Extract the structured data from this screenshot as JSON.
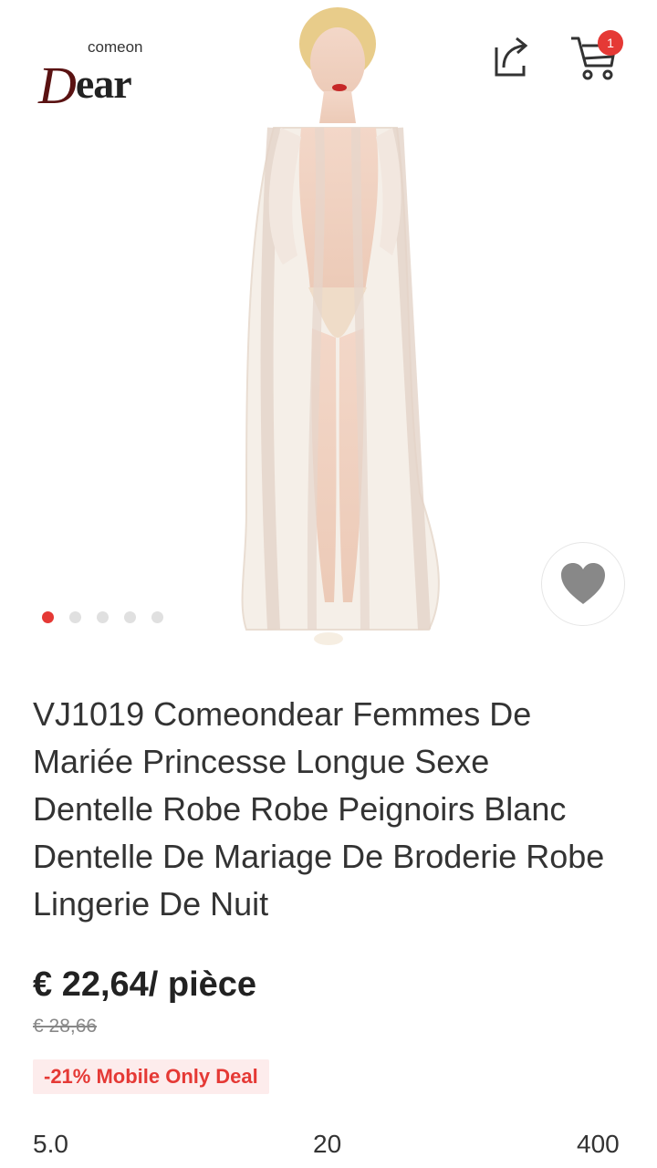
{
  "header": {
    "logo_small": "comeon",
    "logo_big_d": "D",
    "logo_big_rest": "ear",
    "cart_count": "1"
  },
  "gallery": {
    "image_count": 5,
    "active_index": 0
  },
  "product": {
    "title": "VJ1019 Comeondear Femmes De Mariée Princesse Longue Sexe Dentelle Robe Robe Peignoirs Blanc Dentelle De Mariage De Broderie Robe Lingerie De Nuit",
    "price": "€ 22,64/ pièce",
    "old_price": "€ 28,66",
    "deal": "-21% Mobile Only Deal"
  },
  "stats": {
    "rating": "5.0",
    "reviews": "20",
    "orders": "400"
  },
  "colors": {
    "accent": "#e53935",
    "deal_bg": "#fdecec"
  }
}
